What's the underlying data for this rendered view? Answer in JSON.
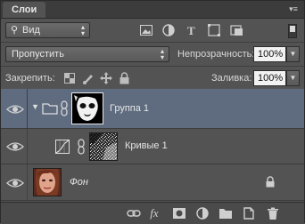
{
  "panel": {
    "tab_label": "Слои",
    "menu_icon": "panel-menu-icon"
  },
  "filter": {
    "kind_label": "Вид",
    "icons": [
      "image-filter-icon",
      "adjustment-filter-icon",
      "type-filter-icon",
      "shape-filter-icon",
      "smart-object-filter-icon"
    ]
  },
  "blend": {
    "mode_value": "Пропустить",
    "opacity_label": "Непрозрачность:",
    "opacity_value": "100%"
  },
  "lock": {
    "label": "Закрепить:",
    "fill_label": "Заливка:",
    "fill_value": "100%"
  },
  "layers": [
    {
      "name": "Группа 1",
      "type": "group",
      "selected": true,
      "expanded": true
    },
    {
      "name": "Кривые 1",
      "type": "adjustment",
      "selected": false
    },
    {
      "name": "Фон",
      "type": "background",
      "selected": false,
      "locked": true
    }
  ],
  "footer": {
    "icons": [
      "link-layers-icon",
      "fx-icon",
      "add-mask-icon",
      "adjustment-layer-icon",
      "new-group-icon",
      "new-layer-icon",
      "delete-layer-icon"
    ],
    "fx_label": "fx"
  }
}
